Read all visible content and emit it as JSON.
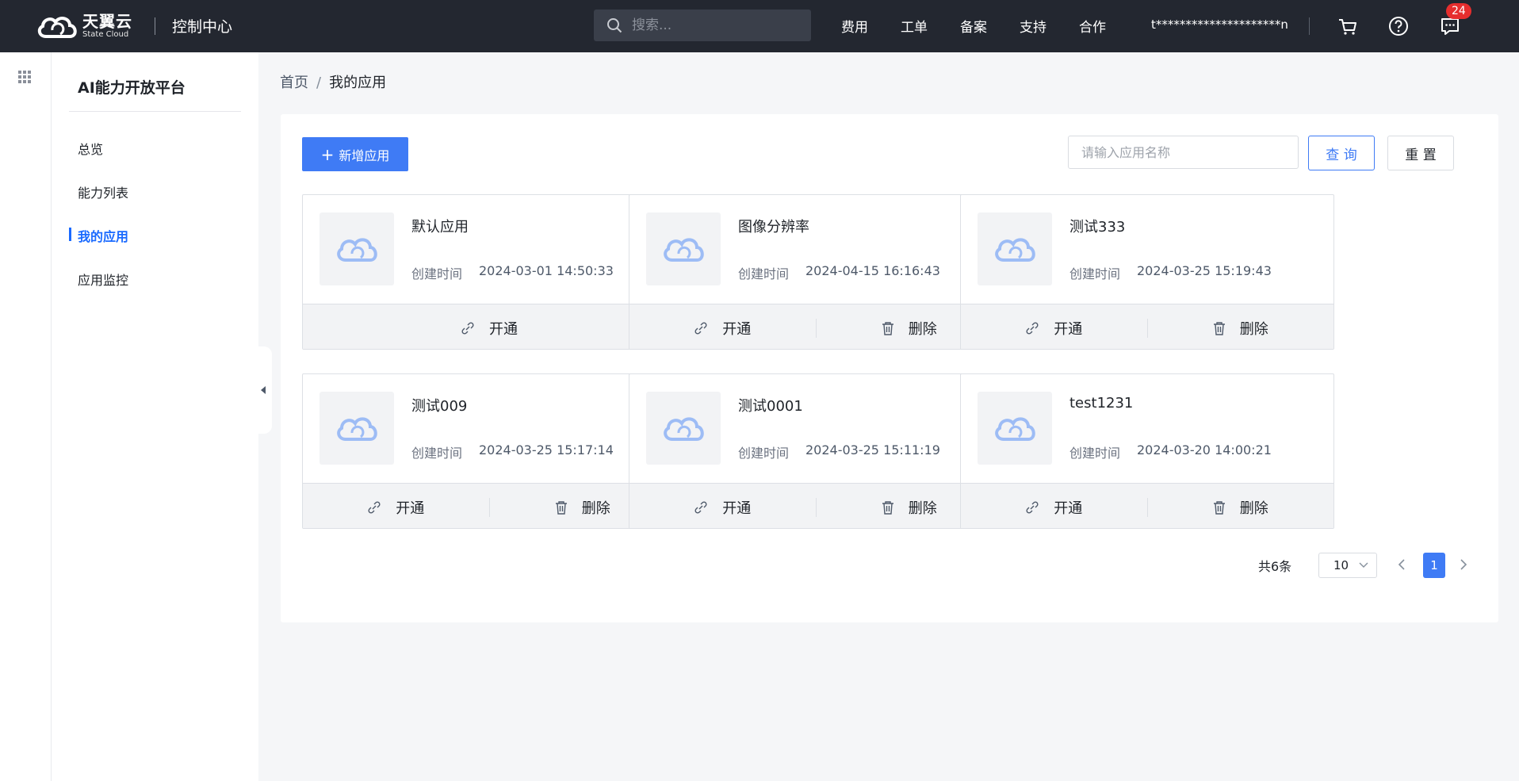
{
  "topbar": {
    "brand_cn": "天翼云",
    "brand_en": "State Cloud",
    "console_title": "控制中心",
    "search_placeholder": "搜索...",
    "nav": [
      "费用",
      "工单",
      "备案",
      "支持",
      "合作"
    ],
    "user": "t*********************n",
    "message_count": "24"
  },
  "sidebar": {
    "title": "AI能力开放平台",
    "items": [
      {
        "label": "总览"
      },
      {
        "label": "能力列表"
      },
      {
        "label": "我的应用"
      },
      {
        "label": "应用监控"
      }
    ],
    "active_index": 2
  },
  "breadcrumb": {
    "home": "首页",
    "sep": "/",
    "current": "我的应用"
  },
  "toolbar": {
    "add_label": "新增应用",
    "search_placeholder": "请输入应用名称",
    "query_label": "查 询",
    "reset_label": "重 置"
  },
  "apps": [
    {
      "name": "默认应用",
      "time_label": "创建时间",
      "created": "2024-03-01 14:50:33",
      "open_label": "开通",
      "delete_label": ""
    },
    {
      "name": "图像分辨率",
      "time_label": "创建时间",
      "created": "2024-04-15 16:16:43",
      "open_label": "开通",
      "delete_label": "删除"
    },
    {
      "name": "测试333",
      "time_label": "创建时间",
      "created": "2024-03-25 15:19:43",
      "open_label": "开通",
      "delete_label": "删除"
    },
    {
      "name": "测试009",
      "time_label": "创建时间",
      "created": "2024-03-25 15:17:14",
      "open_label": "开通",
      "delete_label": "删除"
    },
    {
      "name": "测试0001",
      "time_label": "创建时间",
      "created": "2024-03-25 15:11:19",
      "open_label": "开通",
      "delete_label": "删除"
    },
    {
      "name": "test1231",
      "time_label": "创建时间",
      "created": "2024-03-20 14:00:21",
      "open_label": "开通",
      "delete_label": "删除"
    }
  ],
  "pagination": {
    "total": "共6条",
    "page_size": "10",
    "current_page": "1"
  },
  "colors": {
    "accent": "#3f7bf5",
    "topbar": "#232730",
    "badge": "#e62e2e"
  },
  "icons": {
    "search": "search-icon",
    "cart": "cart-icon",
    "help": "help-icon",
    "message": "message-icon",
    "apps_grid": "grid-icon",
    "app_thumb": "cloud-icon",
    "open": "link-icon",
    "delete": "trash-icon"
  }
}
